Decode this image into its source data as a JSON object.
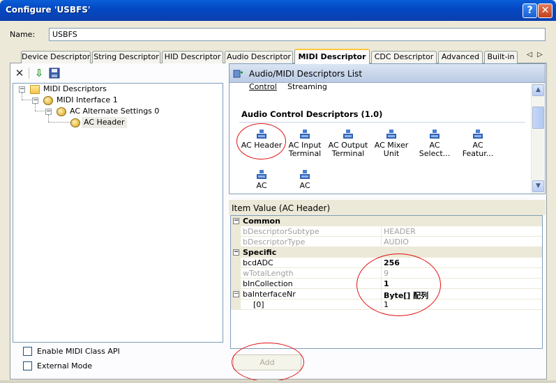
{
  "window": {
    "title": "Configure 'USBFS'",
    "help_glyph": "?",
    "close_glyph": "✕"
  },
  "name_row": {
    "label": "Name:",
    "value": "USBFS"
  },
  "tabs": [
    {
      "label": "Device Descriptor"
    },
    {
      "label": "String Descriptor"
    },
    {
      "label": "HID Descriptor"
    },
    {
      "label": "Audio Descriptor"
    },
    {
      "label": "MIDI Descriptor",
      "active": true
    },
    {
      "label": "CDC Descriptor"
    },
    {
      "label": "Advanced"
    },
    {
      "label": "Built-in"
    }
  ],
  "tab_scroll": {
    "left": "◁",
    "right": "▷"
  },
  "left_toolbar": {
    "icons": [
      "delete-icon",
      "import-icon",
      "save-icon"
    ],
    "delete_glyph": "✕",
    "import_glyph": "⇩",
    "save_glyph": "▪"
  },
  "tree": {
    "root": {
      "label": "MIDI Descriptors",
      "toggle": "−"
    },
    "interface": {
      "label": "MIDI Interface 1",
      "toggle": "−"
    },
    "alt_setting": {
      "label": "AC Alternate Settings 0",
      "toggle": "−"
    },
    "header": {
      "label": "AC Header"
    }
  },
  "options": {
    "enable_midi_class_api": {
      "label": "Enable MIDI Class API",
      "checked": false
    },
    "external_mode": {
      "label": "External Mode",
      "checked": false
    }
  },
  "descriptor_list": {
    "title": "Audio/MIDI Descriptors List",
    "partial_labels": [
      "Control",
      "Streaming"
    ],
    "section_title": "Audio Control Descriptors (1.0)",
    "items": [
      {
        "label_line1": "AC Header",
        "label_line2": ""
      },
      {
        "label_line1": "AC Input",
        "label_line2": "Terminal"
      },
      {
        "label_line1": "AC Output",
        "label_line2": "Terminal"
      },
      {
        "label_line1": "AC Mixer",
        "label_line2": "Unit"
      },
      {
        "label_line1": "AC",
        "label_line2": "Select..."
      },
      {
        "label_line1": "AC",
        "label_line2": "Featur..."
      },
      {
        "label_line1": "AC",
        "label_line2": ""
      },
      {
        "label_line1": "AC",
        "label_line2": ""
      }
    ],
    "scroll_up": "▲",
    "scroll_down": "▼"
  },
  "item_value": {
    "caption": "Item Value (AC Header)",
    "rows": [
      {
        "kind": "category",
        "name": "Common",
        "toggle": "−"
      },
      {
        "kind": "prop",
        "name": "bDescriptorSubtype",
        "value": "HEADER",
        "muted": true
      },
      {
        "kind": "prop",
        "name": "bDescriptorType",
        "value": "AUDIO",
        "muted": true
      },
      {
        "kind": "category",
        "name": "Specific",
        "toggle": "−"
      },
      {
        "kind": "prop",
        "name": "bcdADC",
        "value": "256",
        "bold_value": true
      },
      {
        "kind": "prop",
        "name": "wTotalLength",
        "value": "9",
        "muted": true
      },
      {
        "kind": "prop",
        "name": "bInCollection",
        "value": "1",
        "bold_value": true
      },
      {
        "kind": "prop",
        "name": "baInterfaceNr",
        "value": "Byte[] 配列",
        "bold_value": true,
        "toggle": "−"
      },
      {
        "kind": "prop",
        "name": "[0]",
        "value": "1",
        "indent": true
      }
    ]
  },
  "add_button": {
    "label": "Add",
    "enabled": false
  },
  "colors": {
    "title_bar": "#0349c4",
    "tab_active_accent": "#ffc83c",
    "panel_header": "#b9cbe4",
    "annotation": "#e01010"
  }
}
